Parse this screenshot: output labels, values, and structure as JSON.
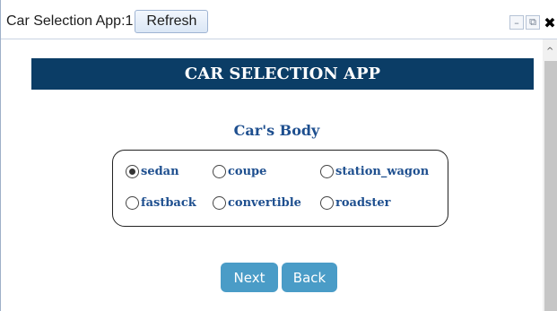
{
  "window": {
    "title": "Car Selection App:1",
    "refresh_label": "Refresh",
    "controls": {
      "minimize": "–",
      "popout": "⧉",
      "close": "✖"
    }
  },
  "app": {
    "banner": "CAR SELECTION APP",
    "section_title": "Car's Body",
    "body_options": [
      {
        "label": "sedan",
        "checked": true
      },
      {
        "label": "coupe",
        "checked": false
      },
      {
        "label": "station_wagon",
        "checked": false
      },
      {
        "label": "fastback",
        "checked": false
      },
      {
        "label": "convertible",
        "checked": false
      },
      {
        "label": "roadster",
        "checked": false
      }
    ],
    "next_label": "Next",
    "back_label": "Back"
  },
  "colors": {
    "banner_bg": "#0b3d66",
    "label_text": "#1e4f8f",
    "button_bg": "#4a9cc7"
  }
}
